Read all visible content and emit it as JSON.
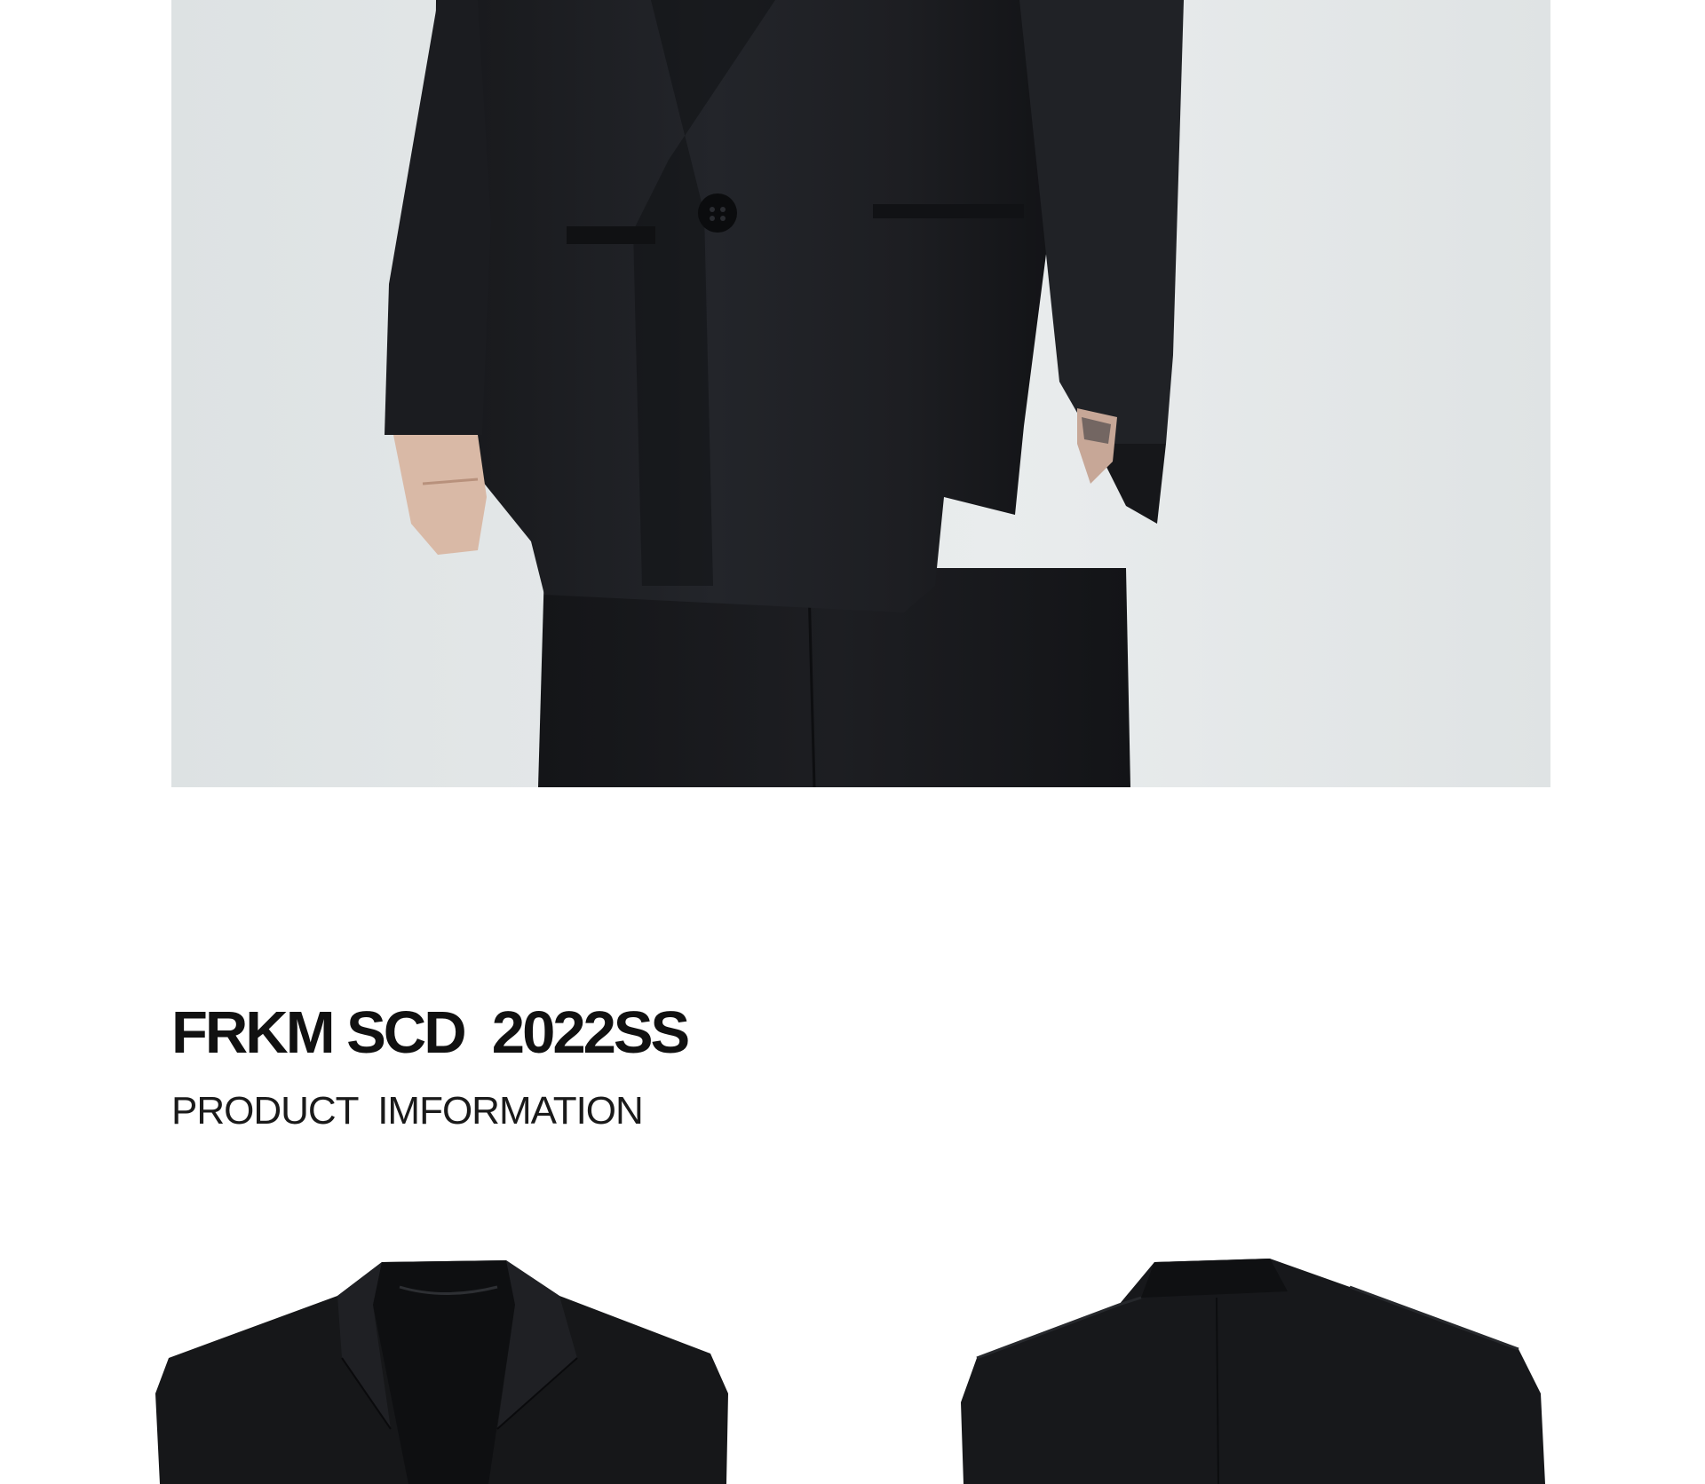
{
  "product": {
    "title": "FRKM SCD  2022SS",
    "subtitle": "PRODUCT  IMFORMATION"
  },
  "images": {
    "hero": {
      "name": "model-wearing-black-blazer-photo",
      "background_color": "#e3e7e8",
      "garment_color": "#1c1d21"
    },
    "front": {
      "name": "blazer-front-view"
    },
    "back": {
      "name": "blazer-back-view"
    }
  },
  "colors": {
    "text": "#111111",
    "background": "#ffffff",
    "garment": "#151619"
  }
}
